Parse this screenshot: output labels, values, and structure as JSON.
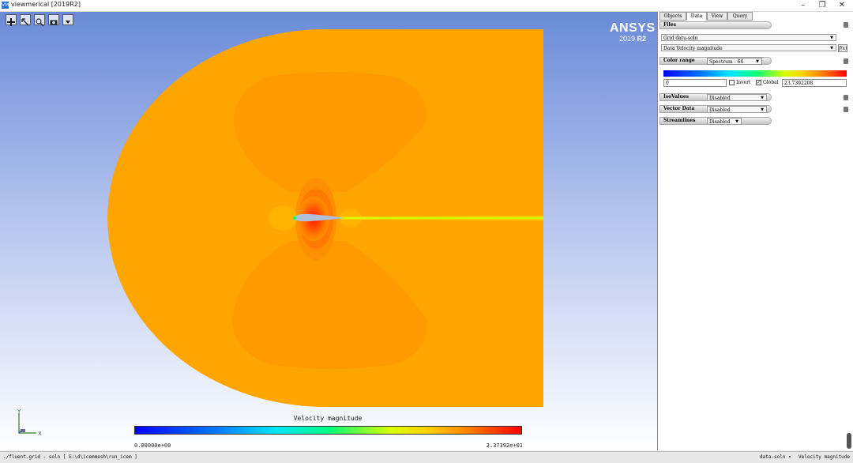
{
  "window": {
    "title": "viewmerical [2019R2]",
    "app_icon": "VM",
    "minimize_glyph": "–",
    "restore_glyph": "❐",
    "close_glyph": "✕"
  },
  "toolbar": {
    "icons": [
      "add-icon",
      "select-arrow-icon",
      "zoom-icon",
      "camera-icon",
      "dropdown-icon"
    ]
  },
  "logo": {
    "name": "ANSYS",
    "version": "2019",
    "release": "R2"
  },
  "legend": {
    "title": "Velocity magnitude",
    "min_label": "0.00000e+00",
    "max_label": "2.37392e+01",
    "colors": [
      "#0000ff",
      "#00e5ff",
      "#00ff80",
      "#d8ff00",
      "#ff7a00",
      "#ff0000"
    ]
  },
  "triad": {
    "y_label": "Y",
    "x_label": "X"
  },
  "status": {
    "left": "./fluent.grid - soln [ E:\\d\\icemmesh\\run_icem ]",
    "right1": "data-soln ▾",
    "right2": "Velocity magnitude"
  },
  "panel": {
    "tabs": [
      "Objects",
      "Data",
      "View",
      "Query"
    ],
    "active_tab": "Data",
    "files": {
      "header": "Files",
      "grid_select": "Grid datu-soln",
      "data_select": "Data Velocity magnitude",
      "fx_button": "f(x)"
    },
    "color_range": {
      "header": "Color range",
      "select": "Spectrum - 64",
      "min_value": "0",
      "invert_label": "Invert",
      "invert_checked": false,
      "global_label": "Global",
      "global_checked": true,
      "max_value": "23.7392208"
    },
    "isovalues": {
      "header": "IsoValues",
      "value": "Disabled"
    },
    "vector_data": {
      "header": "Vector Data",
      "value": "Disabled"
    },
    "streamlines": {
      "header": "Streamlines",
      "value": "Disabled"
    }
  }
}
